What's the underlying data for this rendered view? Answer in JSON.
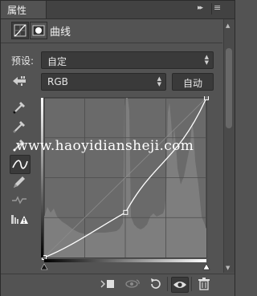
{
  "panel": {
    "tab_label": "属性",
    "collapse_glyph": "▸▸",
    "menu_glyph": "≡"
  },
  "header": {
    "title": "曲线",
    "icons": [
      "curves-adjustment-icon",
      "layer-mask-icon"
    ]
  },
  "preset": {
    "label": "预设:",
    "value": "自定"
  },
  "channel": {
    "value": "RGB",
    "auto_label": "自动"
  },
  "tools": [
    "target-adjust-hand-icon",
    "black-point-eyedropper-icon",
    "gray-point-eyedropper-icon",
    "white-point-eyedropper-icon",
    "edit-curve-icon",
    "pencil-draw-icon",
    "smooth-curve-icon",
    "clipping-warning-icon"
  ],
  "curve": {
    "control_points": [
      [
        0,
        0
      ],
      [
        128,
        72
      ],
      [
        255,
        255
      ]
    ],
    "input_range": [
      0,
      255
    ],
    "output_range": [
      0,
      255
    ]
  },
  "watermark": "www.haoyidiansheji.com",
  "bottom_bar": {
    "icons": [
      "clip-to-layer-icon",
      "view-previous-state-icon",
      "reset-icon",
      "visibility-eye-icon",
      "trash-icon"
    ]
  },
  "colors": {
    "panel_bg": "#535353",
    "field_bg": "#3a3a3a",
    "histogram": "#7c7c7c",
    "curve": "#ffffff"
  }
}
